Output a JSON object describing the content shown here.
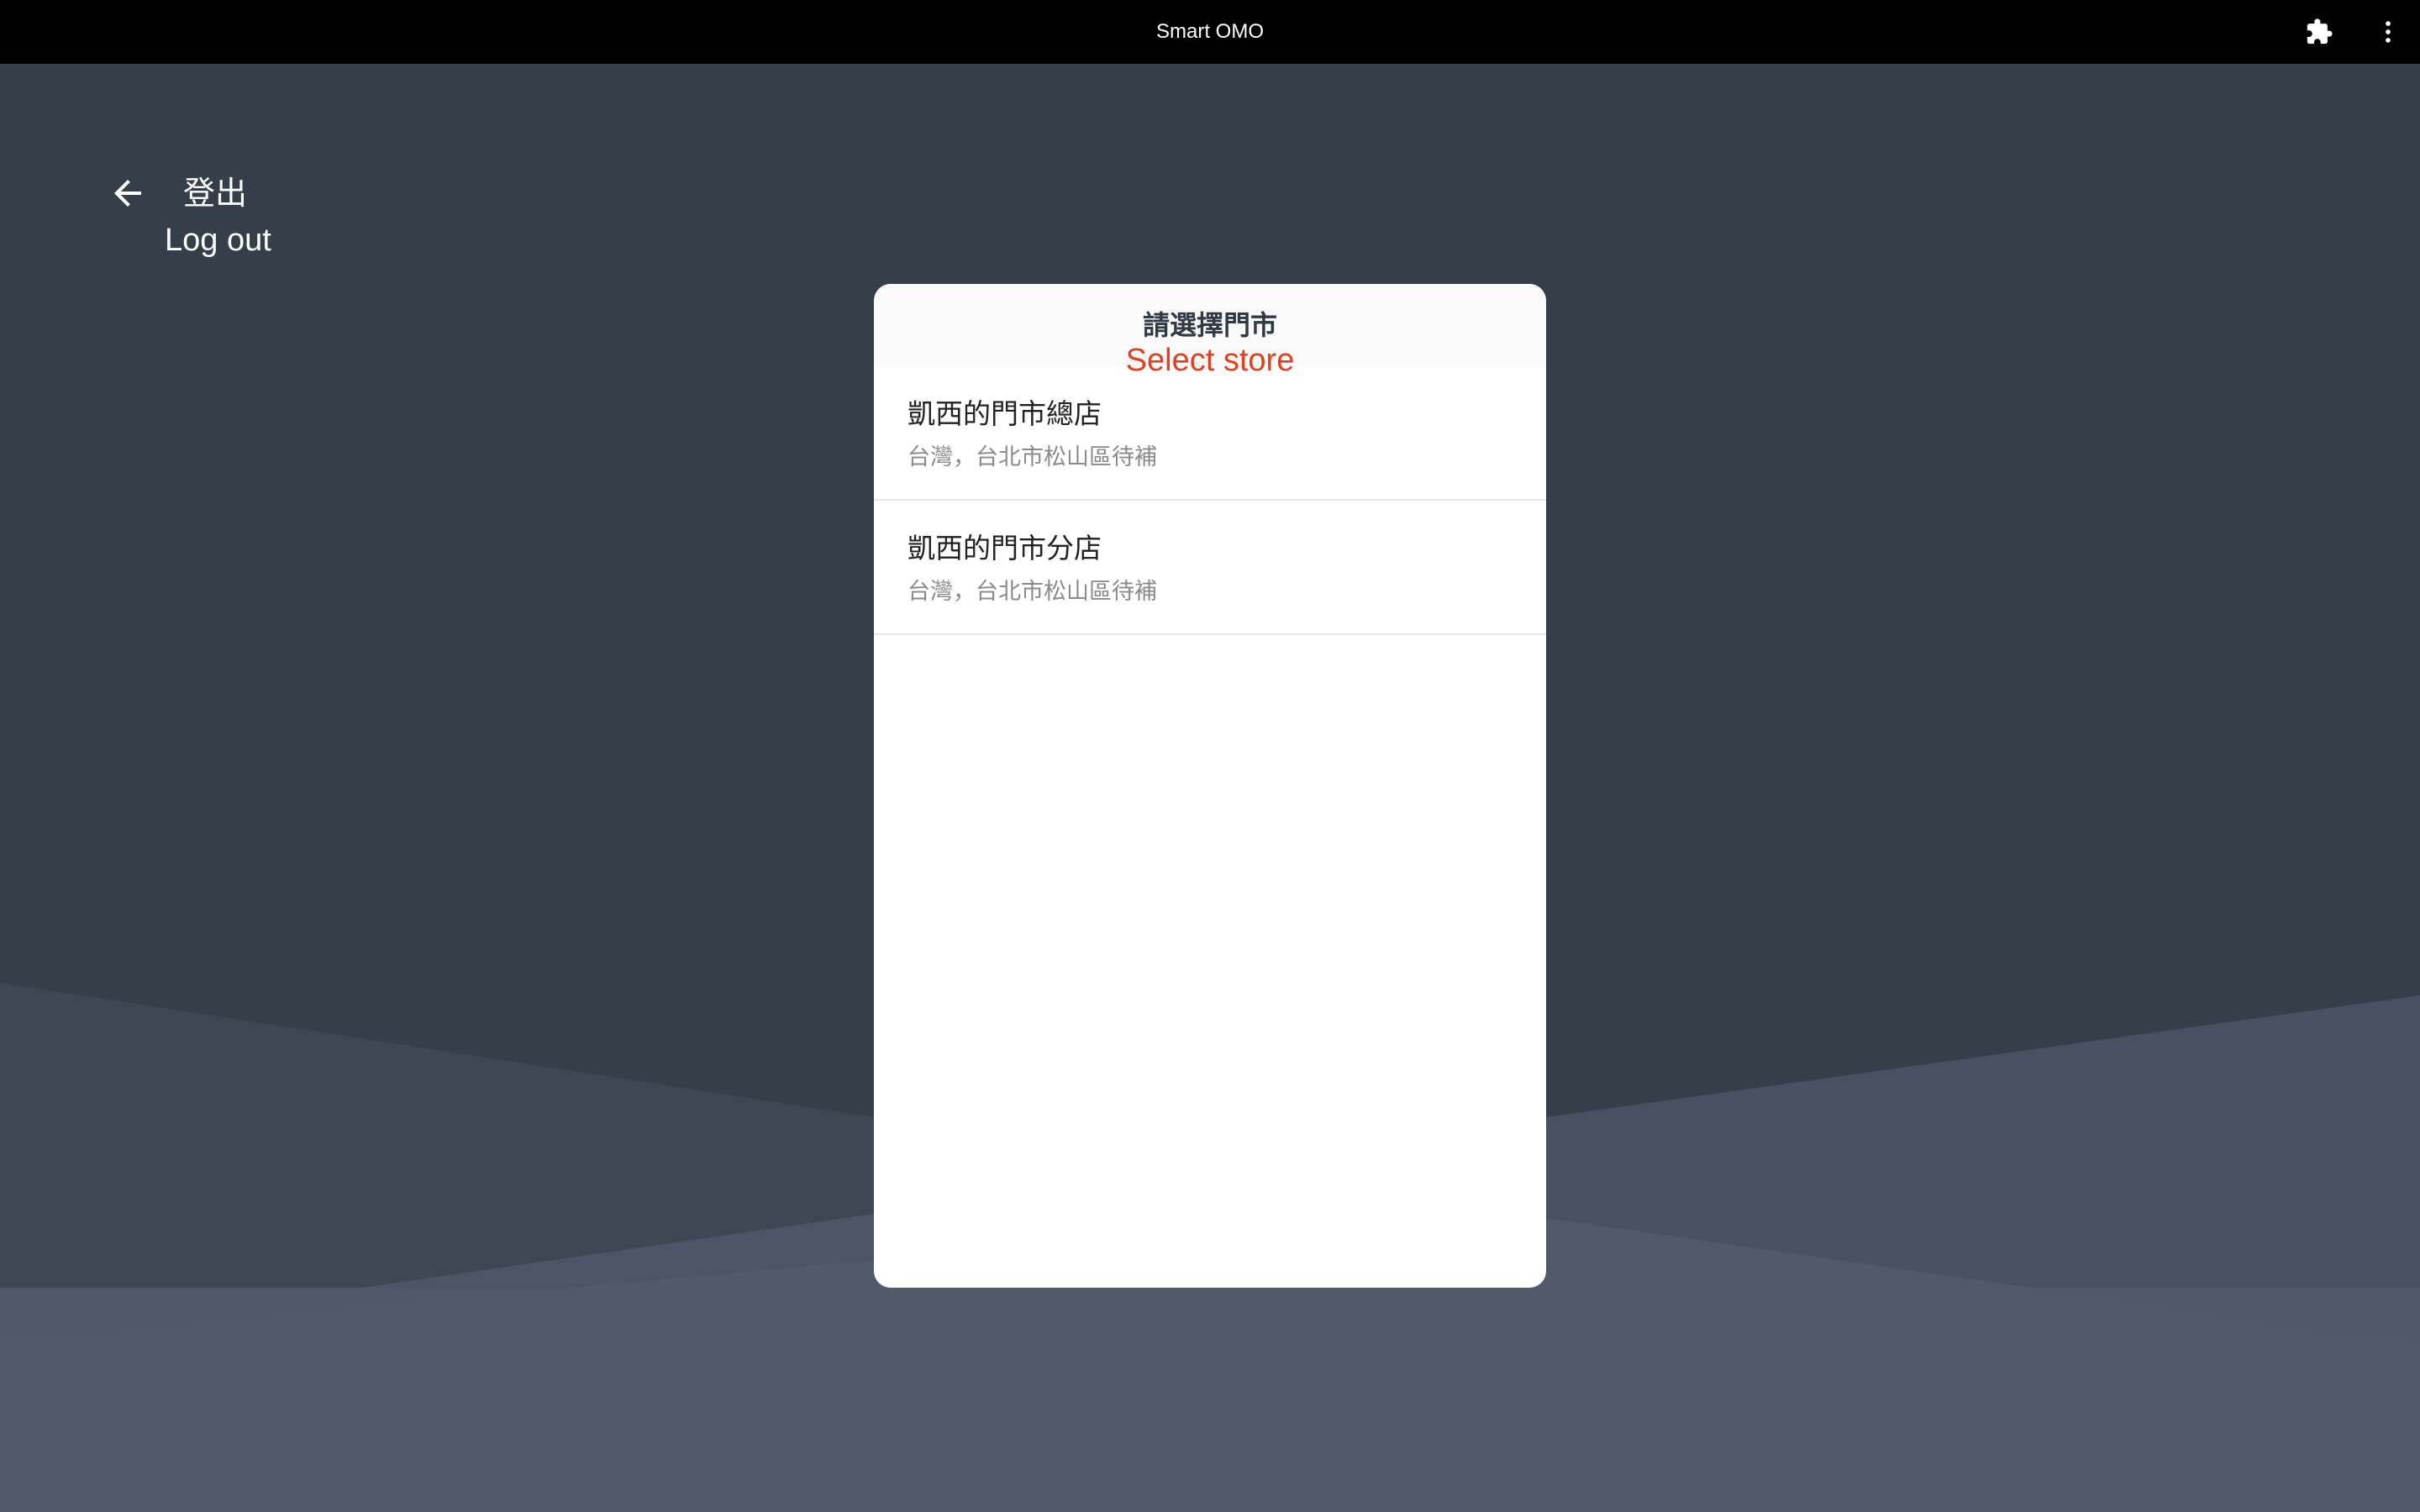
{
  "app": {
    "title": "Smart OMO",
    "extension_icon": "puzzle-icon",
    "menu_icon": "more-vert-icon"
  },
  "back": {
    "icon": "arrow-left-icon",
    "label_zh": "登出",
    "label_en": "Log out"
  },
  "dialog": {
    "title": "請選擇門市",
    "subtitle": "Select store",
    "stores": [
      {
        "name": "凱西的門市總店",
        "address": "台灣，台北市松山區待補"
      },
      {
        "name": "凱西的門市分店",
        "address": "台灣，台北市松山區待補"
      }
    ]
  },
  "colors": {
    "titlebar": "#000000",
    "background": "#353f49",
    "accent": "#e2401f",
    "dialog": "#ffffff"
  }
}
